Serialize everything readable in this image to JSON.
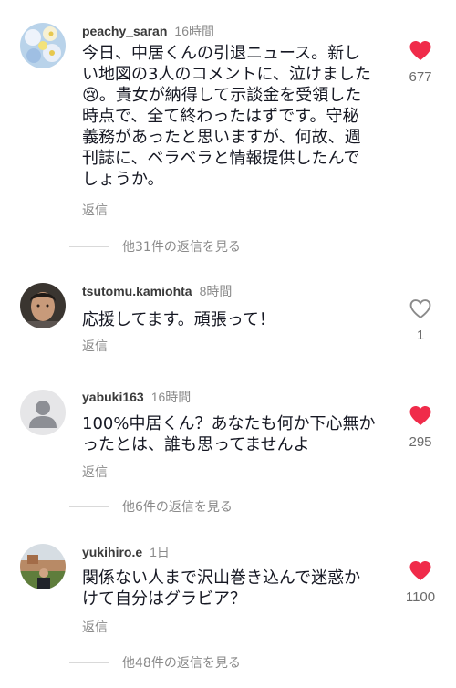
{
  "colors": {
    "like_active": "#f02b4a",
    "like_inactive": "#8a8a8a",
    "muted_text": "#8a8a8a"
  },
  "comments": [
    {
      "username": "peachy_saran",
      "time": "16時間",
      "lines": [
        "今日、中居くんの引退ニュース。新し",
        "い地図の3人のコメントに、泣けました",
        "😢。貴女が納得して示談金を受領した",
        "時点で、全て終わったはずです。守秘",
        "義務があったと思いますが、何故、週",
        "刊誌に、ベラベラと情報提供したんで",
        "しょうか。"
      ],
      "reply_label": "返信",
      "likes": "677",
      "liked": true,
      "more_replies": "他31件の返信を見る",
      "avatar_icon": "flower-photo-avatar"
    },
    {
      "username": "tsutomu.kamiohta",
      "time": "8時間",
      "lines": [
        "応援してます。頑張って！"
      ],
      "reply_label": "返信",
      "likes": "1",
      "liked": false,
      "avatar_icon": "person-photo-avatar"
    },
    {
      "username": "yabuki163",
      "time": "16時間",
      "lines": [
        "100%中居くん？あなたも何か下心無か",
        "ったとは、誰も思ってませんよ"
      ],
      "reply_label": "返信",
      "likes": "295",
      "liked": true,
      "more_replies": "他6件の返信を見る",
      "avatar_icon": "default-user-avatar"
    },
    {
      "username": "yukihiro.e",
      "time": "1日",
      "lines": [
        "関係ない人まで沢山巻き込んで迷惑か",
        "けて自分はグラビア？"
      ],
      "reply_label": "返信",
      "likes": "1100",
      "liked": true,
      "more_replies": "他48件の返信を見る",
      "avatar_icon": "landscape-photo-avatar"
    }
  ]
}
